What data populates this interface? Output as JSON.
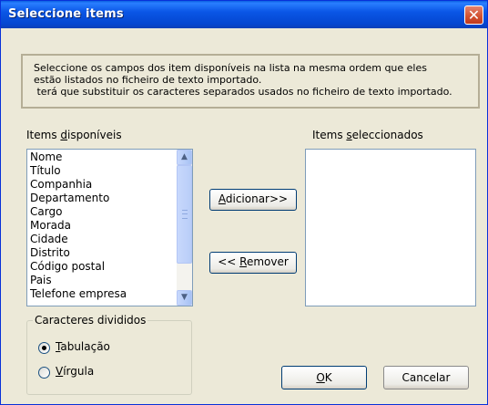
{
  "dialog": {
    "title": "Seleccione items",
    "close_glyph": "✕"
  },
  "instructions": {
    "line1": "Seleccione os campos dos item disponíveis na lista na mesma ordem que eles",
    "line2": "estão listados no ficheiro de texto importado.",
    "line3": " terá que substituir os caracteres separados usados no ficheiro de texto importado."
  },
  "available": {
    "label_pre": "Items ",
    "label_ul": "d",
    "label_post": "isponíveis",
    "items": [
      "Nome",
      "Título",
      "Companhia",
      "Departamento",
      "Cargo",
      "Morada",
      "Cidade",
      "Distrito",
      "Código postal",
      "Pais",
      "Telefone empresa"
    ]
  },
  "selected": {
    "label_pre": "Items ",
    "label_ul": "s",
    "label_post": "eleccionados",
    "items": []
  },
  "buttons": {
    "add": {
      "ul": "A",
      "rest": "dicionar>>"
    },
    "remove": {
      "pre": "<< ",
      "ul": "R",
      "rest": "emover"
    },
    "ok": {
      "ul": "O",
      "rest": "K"
    },
    "cancel": {
      "label": "Cancelar"
    }
  },
  "separators": {
    "title": "Caracteres divididos",
    "tab": {
      "ul": "T",
      "rest": "abulação",
      "selected": true
    },
    "comma": {
      "ul": "V",
      "rest": "írgula",
      "selected": false
    }
  },
  "colors": {
    "titlebar": "#0a56e6",
    "dialog_bg": "#ece9d8",
    "close_button": "#d2502e",
    "radio_dot": "#21a121"
  },
  "icons": {
    "scroll_up": "▲",
    "scroll_down": "▼"
  }
}
